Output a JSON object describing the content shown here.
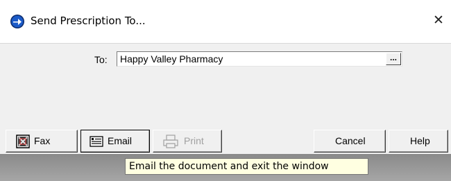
{
  "window": {
    "title": "Send Prescription To...",
    "close_glyph": "✕"
  },
  "form": {
    "to_label": "To:",
    "to_value": "Happy Valley Pharmacy",
    "browse_label": "..."
  },
  "buttons": {
    "fax": "Fax",
    "email": "Email",
    "print": "Print",
    "cancel": "Cancel",
    "help": "Help"
  },
  "tooltip": {
    "text": "Email the document and exit the window"
  },
  "icons": {
    "app": "blue-arrow-globe-icon",
    "fax": "fax-icon",
    "email": "email-icon",
    "print": "printer-icon"
  },
  "colors": {
    "dialog_bg": "#f0f0f0",
    "tooltip_bg": "#ffffe1",
    "app_icon": "#1c5bc8",
    "disabled_text": "#a0a0a0"
  }
}
